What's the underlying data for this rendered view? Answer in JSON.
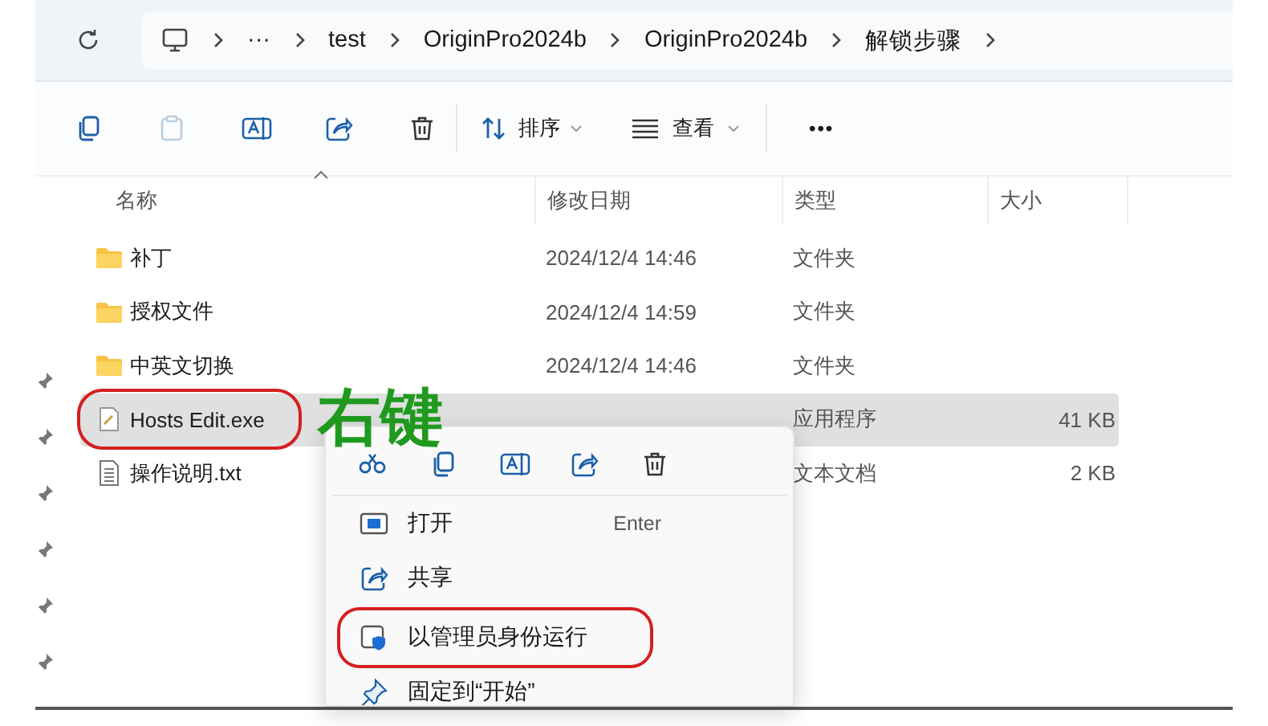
{
  "breadcrumb_more": "···",
  "breadcrumb": [
    "test",
    "OriginPro2024b",
    "OriginPro2024b",
    "解锁步骤"
  ],
  "toolbar": {
    "sort": "排序",
    "view": "查看",
    "more": "•••"
  },
  "columns": [
    "名称",
    "修改日期",
    "类型",
    "大小"
  ],
  "files": [
    {
      "kind": "folder",
      "name": "补丁",
      "date": "2024/12/4 14:46",
      "type": "文件夹",
      "selected": false,
      "circled": false
    },
    {
      "kind": "folder",
      "name": "授权文件",
      "date": "2024/12/4 14:59",
      "type": "文件夹",
      "selected": false,
      "circled": false
    },
    {
      "kind": "folder",
      "name": "中英文切换",
      "date": "2024/12/4 14:46",
      "type": "文件夹",
      "selected": false,
      "circled": false
    },
    {
      "kind": "exe",
      "name": "Hosts Edit.exe",
      "type": "应用程序",
      "size": "41 KB",
      "selected": true,
      "circled": true
    },
    {
      "kind": "text",
      "name": "操作说明.txt",
      "type": "文本文档",
      "size": "2 KB",
      "selected": false,
      "circled": false
    }
  ],
  "annotation": "右键",
  "context_menu": {
    "items": [
      {
        "kind": "open",
        "label": "打开",
        "shortcut": "Enter",
        "circled": false
      },
      {
        "kind": "share",
        "label": "共享",
        "circled": false
      },
      {
        "kind": "admin",
        "label": "以管理员身份运行",
        "circled": true
      },
      {
        "kind": "pin",
        "label": "固定到“开始”",
        "circled": false
      }
    ]
  }
}
